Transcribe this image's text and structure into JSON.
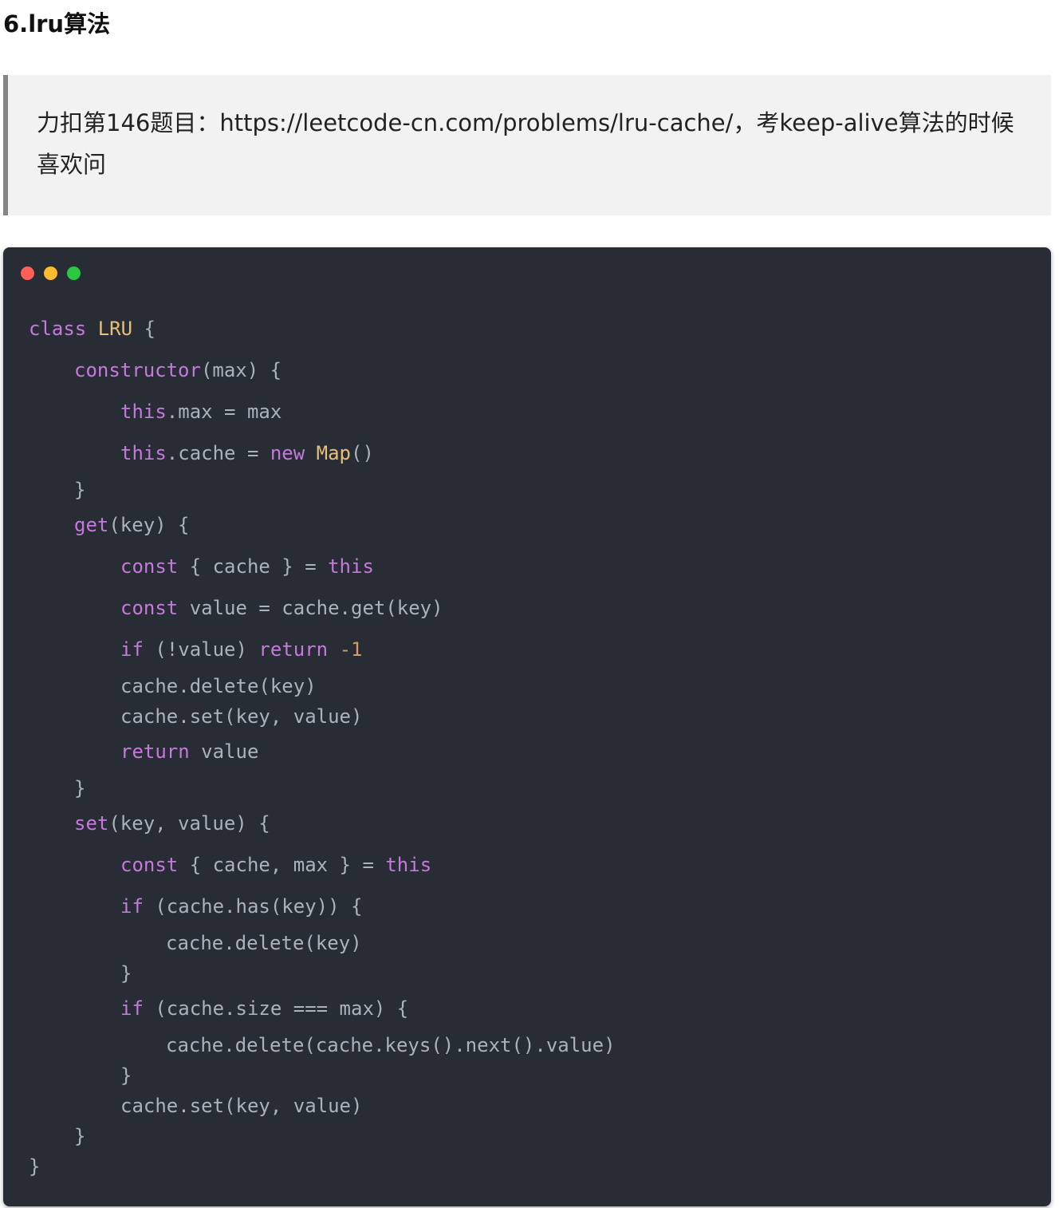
{
  "heading": "6.lru算法",
  "quote": "力扣第146题目：https://leetcode-cn.com/problems/lru-cache/，考keep-alive算法的时候喜欢问",
  "window_dots": [
    "#fe5f57",
    "#febc2e",
    "#29c840"
  ],
  "code_lines": [
    {
      "indent": 0,
      "tokens": [
        [
          "kw",
          "class"
        ],
        [
          "p",
          " "
        ],
        [
          "cls",
          "LRU"
        ],
        [
          "p",
          " {"
        ]
      ]
    },
    {
      "indent": 1,
      "tokens": [
        [
          "kw",
          "constructor"
        ],
        [
          "p",
          "(max) {"
        ]
      ]
    },
    {
      "indent": 2,
      "tokens": [
        [
          "kw",
          "this"
        ],
        [
          "p",
          ".max = max"
        ]
      ]
    },
    {
      "indent": 2,
      "tokens": [
        [
          "kw",
          "this"
        ],
        [
          "p",
          ".cache = "
        ],
        [
          "kw",
          "new"
        ],
        [
          "p",
          " "
        ],
        [
          "cls",
          "Map"
        ],
        [
          "p",
          "()"
        ]
      ]
    },
    {
      "indent": 1,
      "tokens": [
        [
          "p",
          "}"
        ]
      ]
    },
    {
      "indent": 1,
      "tokens": [
        [
          "kw",
          "get"
        ],
        [
          "p",
          "(key) {"
        ]
      ]
    },
    {
      "indent": 2,
      "tokens": [
        [
          "kw",
          "const"
        ],
        [
          "p",
          " { cache } = "
        ],
        [
          "kw",
          "this"
        ]
      ]
    },
    {
      "indent": 2,
      "tokens": [
        [
          "kw",
          "const"
        ],
        [
          "p",
          " value = cache.get(key)"
        ]
      ]
    },
    {
      "indent": 2,
      "tokens": [
        [
          "kw",
          "if"
        ],
        [
          "p",
          " (!value) "
        ],
        [
          "kw",
          "return"
        ],
        [
          "p",
          " "
        ],
        [
          "num",
          "-1"
        ]
      ]
    },
    {
      "indent": 2,
      "tokens": [
        [
          "p",
          "cache.delete(key)"
        ]
      ]
    },
    {
      "indent": 2,
      "tokens": [
        [
          "p",
          "cache.set(key, value)"
        ]
      ]
    },
    {
      "indent": 2,
      "tokens": [
        [
          "kw",
          "return"
        ],
        [
          "p",
          " value"
        ]
      ]
    },
    {
      "indent": 1,
      "tokens": [
        [
          "p",
          "}"
        ]
      ]
    },
    {
      "indent": 1,
      "tokens": [
        [
          "kw",
          "set"
        ],
        [
          "p",
          "(key, value) {"
        ]
      ]
    },
    {
      "indent": 2,
      "tokens": [
        [
          "kw",
          "const"
        ],
        [
          "p",
          " { cache, max } = "
        ],
        [
          "kw",
          "this"
        ]
      ]
    },
    {
      "indent": 2,
      "tokens": [
        [
          "kw",
          "if"
        ],
        [
          "p",
          " (cache.has(key)) {"
        ]
      ]
    },
    {
      "indent": 3,
      "tokens": [
        [
          "p",
          "cache.delete(key)"
        ]
      ]
    },
    {
      "indent": 2,
      "tokens": [
        [
          "p",
          "}"
        ]
      ]
    },
    {
      "indent": 2,
      "tokens": [
        [
          "kw",
          "if"
        ],
        [
          "p",
          " (cache.size === max) {"
        ]
      ]
    },
    {
      "indent": 3,
      "tokens": [
        [
          "p",
          "cache.delete(cache.keys().next().value)"
        ]
      ]
    },
    {
      "indent": 2,
      "tokens": [
        [
          "p",
          "}"
        ]
      ]
    },
    {
      "indent": 2,
      "tokens": [
        [
          "p",
          "cache.set(key, value)"
        ]
      ]
    },
    {
      "indent": 1,
      "tokens": [
        [
          "p",
          "}"
        ]
      ]
    },
    {
      "indent": 0,
      "tokens": [
        [
          "p",
          "}"
        ]
      ]
    }
  ]
}
